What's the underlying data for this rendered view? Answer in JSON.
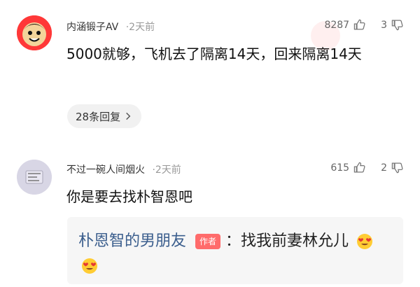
{
  "comments": [
    {
      "username": "内涵锻子AV",
      "time": "·2天前",
      "likes": "8287",
      "dislikes": "3",
      "text": "5000就够，飞机去了隔离14天，回来隔离14天",
      "reply_count": "28条回复"
    },
    {
      "username": "不过一碗人间烟火",
      "time": "·2天前",
      "likes": "615",
      "dislikes": "2",
      "text": "你是要去找朴智恩吧",
      "reply": {
        "author": "朴恩智的男朋友",
        "badge": "作者",
        "text": "：找我前妻林允儿"
      }
    }
  ],
  "icons": {
    "like": "thumb-up-icon",
    "dislike": "thumb-down-icon",
    "chevron": "chevron-right-icon",
    "emoji": "heart-eyes-emoji-icon"
  }
}
